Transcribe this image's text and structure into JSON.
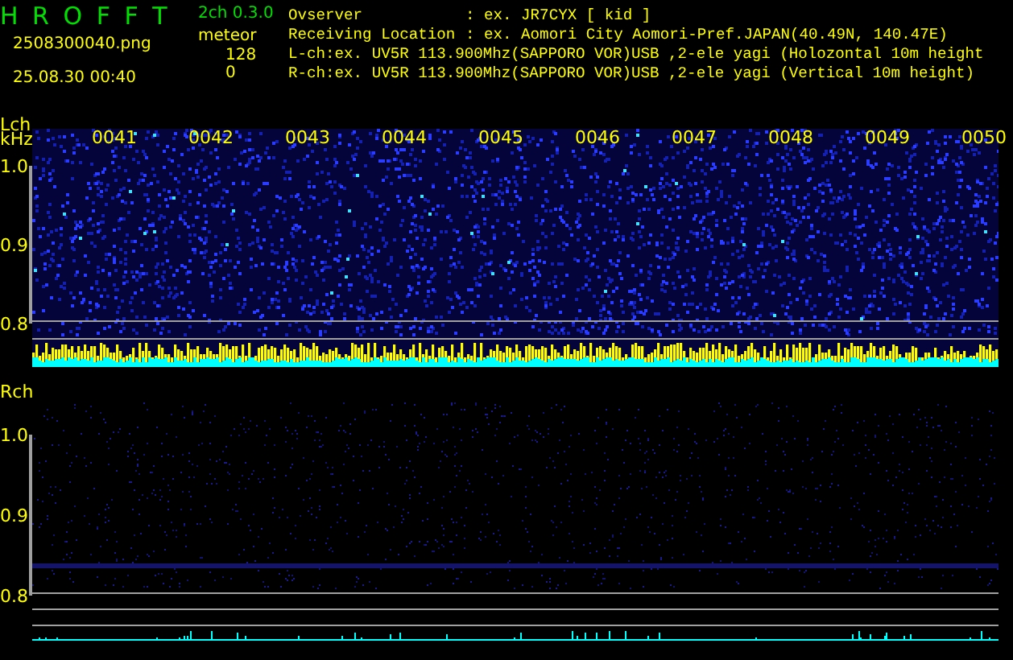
{
  "app": {
    "title": "H R O F F T",
    "version": "2ch 0.3.0",
    "filename": "2508300040.png",
    "timestamp": "25.08.30 00:40"
  },
  "counts": {
    "label": "meteor",
    "lch": "128",
    "rch": "0"
  },
  "info": [
    {
      "label": "Ovserver",
      "value": ": ex. JR7CYX [ kid ]"
    },
    {
      "label": "Receiving Location",
      "value": ": ex. Aomori City Aomori-Pref.JAPAN(40.49N, 140.47E)"
    }
  ],
  "channel_lines": [
    "L-ch:ex. UV5R 113.900Mhz(SAPPORO VOR)USB ,2-ele yagi (Holozontal 10m height",
    "R-ch:ex. UV5R 113.900Mhz(SAPPORO VOR)USB ,2-ele yagi (Vertical 10m height)"
  ],
  "time_labels": [
    "0041",
    "0042",
    "0043",
    "0044",
    "0045",
    "0046",
    "0047",
    "0048",
    "0049",
    "0050"
  ],
  "panels": [
    {
      "kind": "active",
      "name": "Lch",
      "unit": "kHz",
      "ticks": [
        "1.0",
        "0.9",
        "0.8"
      ]
    },
    {
      "kind": "quiet",
      "name": "Rch",
      "ticks": [
        "1.0",
        "0.9",
        "0.8"
      ]
    }
  ]
}
